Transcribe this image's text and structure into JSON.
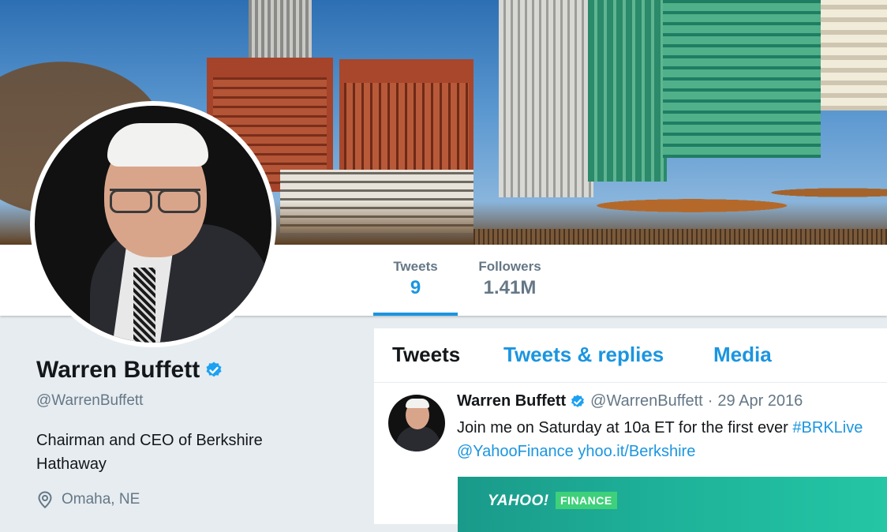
{
  "profile": {
    "name": "Warren Buffett",
    "handle": "@WarrenBuffett",
    "bio": "Chairman and CEO of Berkshire Hathaway",
    "location": "Omaha, NE"
  },
  "stats": {
    "tweets_label": "Tweets",
    "tweets_value": "9",
    "followers_label": "Followers",
    "followers_value": "1.41M"
  },
  "tabs": {
    "tweets": "Tweets",
    "replies": "Tweets & replies",
    "media": "Media"
  },
  "tweet": {
    "name": "Warren Buffett",
    "handle": "@WarrenBuffett",
    "dot": "·",
    "date": "29 Apr 2016",
    "text_1": "Join me on Saturday at 10a ET for the first ever ",
    "hashtag": "#BRKLive",
    "mention": "@YahooFinance",
    "link": "yhoo.it/Berkshire",
    "card_brand": "YAHOO!",
    "card_tag": "FINANCE"
  },
  "colors": {
    "accent": "#1b95e0",
    "verified": "#1da1f2",
    "muted": "#657786"
  }
}
